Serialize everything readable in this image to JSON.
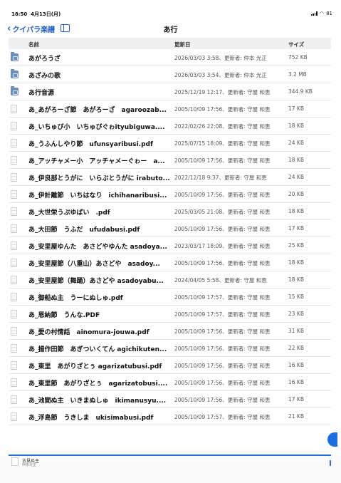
{
  "status": {
    "time": "18:50",
    "date": "4月13日(月)",
    "battery": "81"
  },
  "nav": {
    "back_label": "クイパラ楽譜",
    "title": "あ行"
  },
  "columns": {
    "name": "名前",
    "date": "更新日",
    "size": "サイズ"
  },
  "rows": [
    {
      "type": "folder",
      "name": "あがろうざ",
      "date": "2026/03/03 3:58、更新者: 仲本 光正",
      "size": "752 KB"
    },
    {
      "type": "folder",
      "name": "あざみの歌",
      "date": "2026/03/03 3:54、更新者: 仲本 光正",
      "size": "3.2 MB"
    },
    {
      "type": "folder",
      "name": "あ行音源",
      "date": "2025/12/19 12:17、更新者: 守屋 和恵",
      "size": "344.9 KB"
    },
    {
      "type": "pdf",
      "name": "あ_あがろーざ節　あがろーざ　agaroozab...",
      "date": "2005/10/09 17:56、更新者: 守屋 和恵",
      "size": "17 KB"
    },
    {
      "type": "pdf",
      "name": "あ_いちゅび小　いちゅびぐゎityubiguwa....",
      "date": "2022/02/26 22:08、更新者: 守屋 和恵",
      "size": "18 KB"
    },
    {
      "type": "pdf",
      "name": "あ_うふんしやり節　ufunsyaribusi.pdf",
      "date": "2025/07/15 18:09、更新者: 守屋 和恵",
      "size": "24 KB"
    },
    {
      "type": "pdf",
      "name": "あ_アッチャメー小　アッチャメーぐゎー　a...",
      "date": "2005/10/09 17:56、更新者: 守屋 和恵",
      "size": "18 KB"
    },
    {
      "type": "pdf",
      "name": "あ_伊良部とうがに　いらぶとうがに irabuto...",
      "date": "2022/12/18 9:37、更新者: 守屋 和恵",
      "size": "24 KB"
    },
    {
      "type": "pdf",
      "name": "あ_伊計離節　いちはなり　ichihanaribusi...",
      "date": "2005/10/09 17:56、更新者: 守屋 和恵",
      "size": "20 KB"
    },
    {
      "type": "pdf",
      "name": "あ_大世栄うぷゆばい　.pdf",
      "date": "2025/03/05 21:08、更新者: 守屋 和恵",
      "size": "18 KB"
    },
    {
      "type": "pdf",
      "name": "あ_大田節　うふだ　ufudabusi.pdf",
      "date": "2005/10/09 17:56、更新者: 守屋 和恵",
      "size": "17 KB"
    },
    {
      "type": "pdf",
      "name": "あ_安里屋ゆんた　あさどやゆんた asadoya...",
      "date": "2023/03/17 18:09、更新者: 守屋 和恵",
      "size": "25 KB"
    },
    {
      "type": "pdf",
      "name": "あ_安里屋節（八重山）あさどや　asadoy...",
      "date": "2005/10/09 17:56、更新者: 守屋 和恵",
      "size": "18 KB"
    },
    {
      "type": "pdf",
      "name": "あ_安里屋節（舞踊）あさどや asadoyabu...",
      "date": "2024/04/05 5:58、更新者: 守屋 和恵",
      "size": "18 KB"
    },
    {
      "type": "pdf",
      "name": "あ_御船ぬ主　うーにぬしゅ.pdf",
      "date": "2005/10/09 17:57、更新者: 守屋 和恵",
      "size": "15 KB"
    },
    {
      "type": "pdf",
      "name": "あ_恩納節　うんな.PDF",
      "date": "2005/10/09 17:57、更新者: 守屋 和恵",
      "size": "23 KB"
    },
    {
      "type": "pdf",
      "name": "あ_愛の村情話　ainomura-jouwa.pdf",
      "date": "2005/10/09 17:56、更新者: 守屋 和恵",
      "size": "31 KB"
    },
    {
      "type": "pdf",
      "name": "あ_揚作田節　あぎついくてん agichikuten...",
      "date": "2005/10/09 17:56、更新者: 守屋 和恵",
      "size": "22 KB"
    },
    {
      "type": "pdf",
      "name": "あ_東里　あがりざとぅ agarizatubusi.pdf",
      "date": "2005/10/09 17:56、更新者: 守屋 和恵",
      "size": "16 KB"
    },
    {
      "type": "pdf",
      "name": "あ_東里節　あがりざとぅ　agarizatobusi....",
      "date": "2005/10/09 17:56、更新者: 守屋 和恵",
      "size": "16 KB"
    },
    {
      "type": "pdf",
      "name": "あ_池間ぬ主　いきまぬしゅ　ikimanusyu....",
      "date": "2005/10/09 17:56、更新者: 守屋 和恵",
      "size": "17 KB"
    },
    {
      "type": "pdf",
      "name": "あ_浮島節　うきしま　ukisimabusi.pdf",
      "date": "2005/10/09 17:57、更新者: 守屋 和恵",
      "size": "21 KB"
    }
  ],
  "bottom": {
    "title": "古見ぬ主",
    "subtitle": "仲本光正"
  }
}
